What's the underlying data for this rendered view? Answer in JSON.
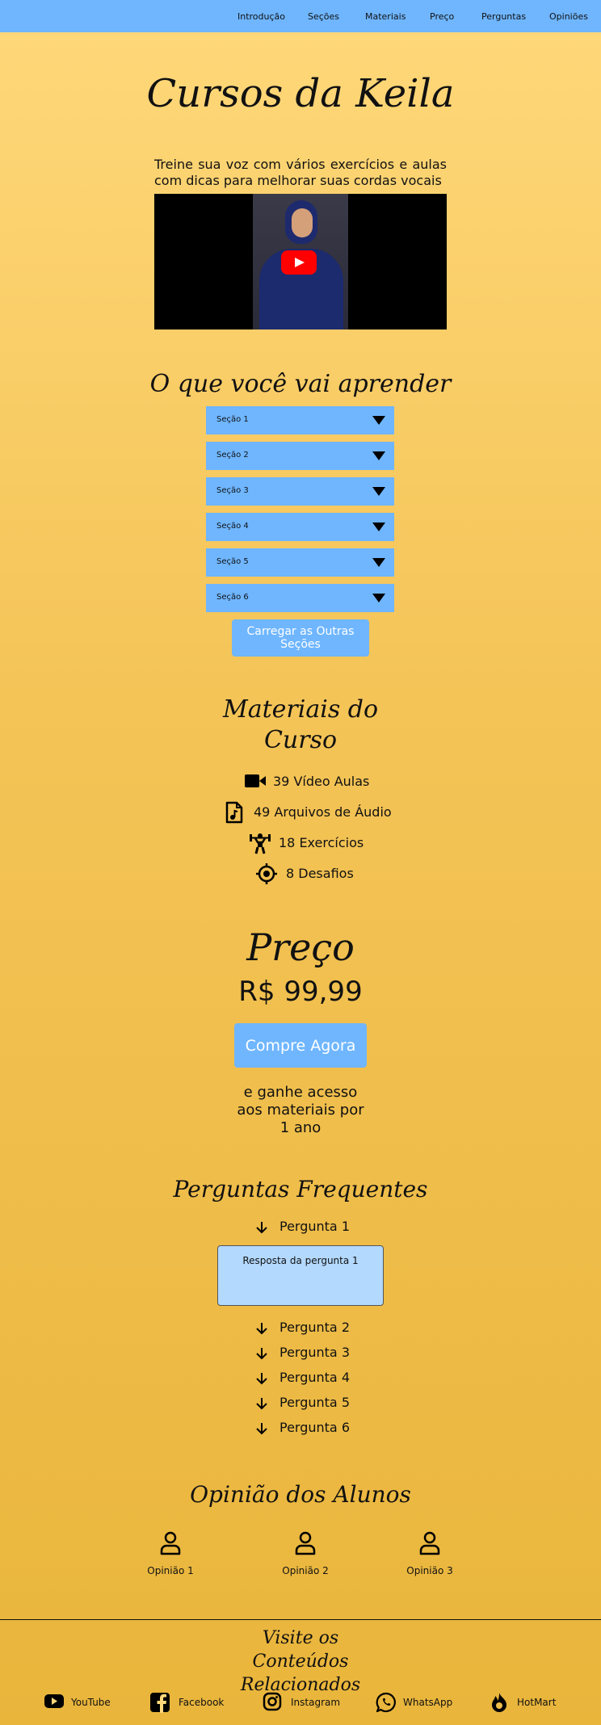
{
  "nav": {
    "items": [
      "Introdução",
      "Seções",
      "Materiais",
      "Preço",
      "Perguntas",
      "Opiniões"
    ]
  },
  "hero": {
    "title": "Cursos da Keila",
    "description": "Treine sua voz com vários exercícios e aulas com dicas para melhorar suas cordas vocais"
  },
  "sections": {
    "title": "O que você vai aprender",
    "items": [
      "Seção 1",
      "Seção 2",
      "Seção 3",
      "Seção 4",
      "Seção 5",
      "Seção 6"
    ],
    "load_more": "Carregar as Outras Seções"
  },
  "materials": {
    "title": "Materiais do Curso",
    "items": [
      {
        "icon": "video-camera-icon",
        "label": "39 Vídeo Aulas"
      },
      {
        "icon": "audio-file-icon",
        "label": "49 Arquivos de Áudio"
      },
      {
        "icon": "weightlifting-icon",
        "label": "18 Exercícios"
      },
      {
        "icon": "target-icon",
        "label": "8 Desafios"
      }
    ]
  },
  "price": {
    "title": "Preço",
    "value": "R$ 99,99",
    "buy_label": "Compre Agora",
    "note": "e ganhe acesso aos materiais por 1 ano"
  },
  "faq": {
    "title": "Perguntas Frequentes",
    "items": [
      "Pergunta 1",
      "Pergunta 2",
      "Pergunta 3",
      "Pergunta 4",
      "Pergunta 5",
      "Pergunta 6"
    ],
    "answer": "Resposta da pergunta 1"
  },
  "opinions": {
    "title": "Opinião dos Alunos",
    "items": [
      "Opinião 1",
      "Opinião 2",
      "Opinião 3"
    ]
  },
  "footer": {
    "title": "Visite os Conteúdos Relacionados",
    "links": [
      {
        "icon": "youtube-icon",
        "label": "YouTube"
      },
      {
        "icon": "facebook-icon",
        "label": "Facebook"
      },
      {
        "icon": "instagram-icon",
        "label": "Instagram"
      },
      {
        "icon": "whatsapp-icon",
        "label": "WhatsApp"
      },
      {
        "icon": "hotmart-flame-icon",
        "label": "HotMart"
      }
    ]
  },
  "colors": {
    "nav_bg": "#6fb6ff",
    "button_bg": "#6fb6ff",
    "answer_bg": "#b3d9ff",
    "bg_top": "#ffd87a",
    "bg_bottom": "#e9b53b"
  }
}
